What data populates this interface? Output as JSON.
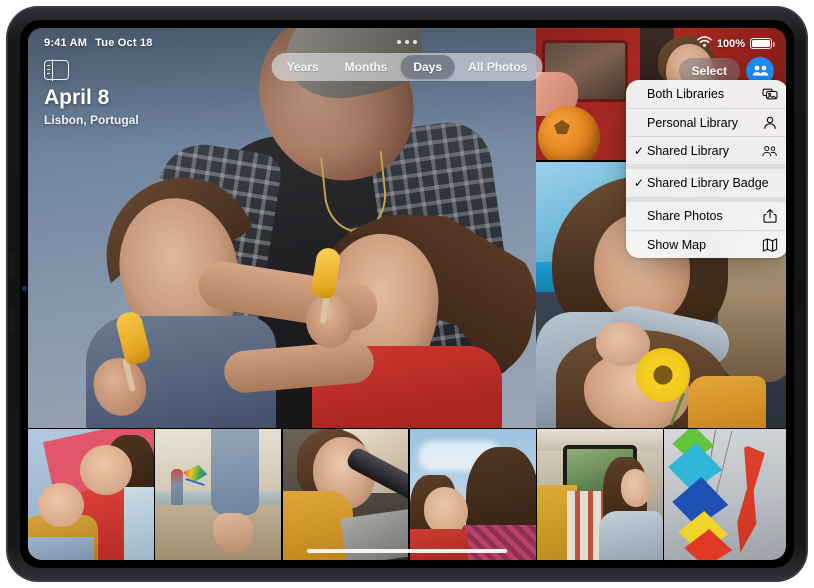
{
  "device": {
    "name": "ipad"
  },
  "status_bar": {
    "time": "9:41 AM",
    "date": "Tue Oct 18",
    "wifi_icon": "wifi-icon",
    "battery_percent": "100%",
    "battery_icon": "battery-full-icon"
  },
  "multitask": {
    "icon": "multitask-dots-icon",
    "dots": 3
  },
  "sidebar_toggle": {
    "icon": "sidebar-toggle-icon"
  },
  "hero": {
    "title": "April 8",
    "subtitle": "Lisbon, Portugal"
  },
  "segmented_control": {
    "selected": "Days",
    "items": [
      {
        "label": "Years",
        "active": false
      },
      {
        "label": "Months",
        "active": false
      },
      {
        "label": "Days",
        "active": true
      },
      {
        "label": "All Photos",
        "active": false
      }
    ]
  },
  "toolbar": {
    "select_label": "Select",
    "avatar_icon": "shared-library-people-icon",
    "avatar_color": "#1b8cf5"
  },
  "context_menu": {
    "groups": [
      {
        "items": [
          {
            "label": "Both Libraries",
            "checked": false,
            "icon": "both-libraries-icon"
          },
          {
            "label": "Personal Library",
            "checked": false,
            "icon": "person-icon"
          },
          {
            "label": "Shared Library",
            "checked": true,
            "icon": "two-people-icon"
          }
        ]
      },
      {
        "items": [
          {
            "label": "Shared Library Badge",
            "checked": true,
            "icon": ""
          }
        ]
      },
      {
        "items": [
          {
            "label": "Share Photos",
            "checked": false,
            "icon": "share-icon"
          },
          {
            "label": "Show Map",
            "checked": false,
            "icon": "map-icon"
          }
        ]
      }
    ],
    "checkmark": "✓"
  },
  "photos": {
    "hero_photo": "man-with-two-girls-eating-popsicles",
    "right_top_photo": "girl-with-orange-ball-by-red-van",
    "right_bottom_photo": "girl-placing-sunflower-behind-ear",
    "filmstrip": [
      {
        "name": "two-girls-lying-down-pink-wall"
      },
      {
        "name": "bare-feet-on-beach-with-kite"
      },
      {
        "name": "girl-leaning-on-car-window"
      },
      {
        "name": "two-girls-against-sky"
      },
      {
        "name": "girl-in-van-looking-out-window"
      },
      {
        "name": "colorful-kites-and-red-ribbon"
      }
    ]
  },
  "home_indicator": {
    "name": "home-indicator"
  }
}
